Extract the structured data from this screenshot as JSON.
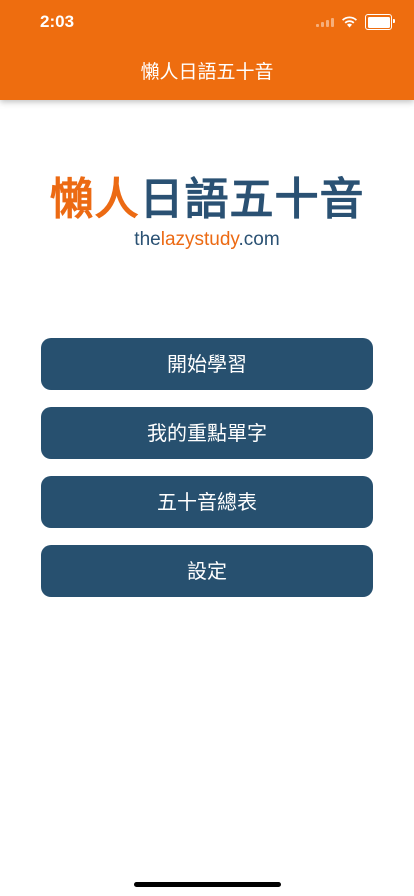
{
  "status_bar": {
    "time": "2:03"
  },
  "header": {
    "title": "懶人日語五十音",
    "background": "#ee6d0f"
  },
  "logo": {
    "main_orange": "懶人",
    "main_blue": "日語五十音",
    "sub_prefix": "the",
    "sub_highlight": "lazystudy",
    "sub_suffix": ".com",
    "colors": {
      "orange": "#ec6a13",
      "blue": "#2a5173"
    }
  },
  "menu": {
    "button_color": "#27506f",
    "items": [
      {
        "label": "開始學習"
      },
      {
        "label": "我的重點單字"
      },
      {
        "label": "五十音總表"
      },
      {
        "label": "設定"
      }
    ]
  }
}
